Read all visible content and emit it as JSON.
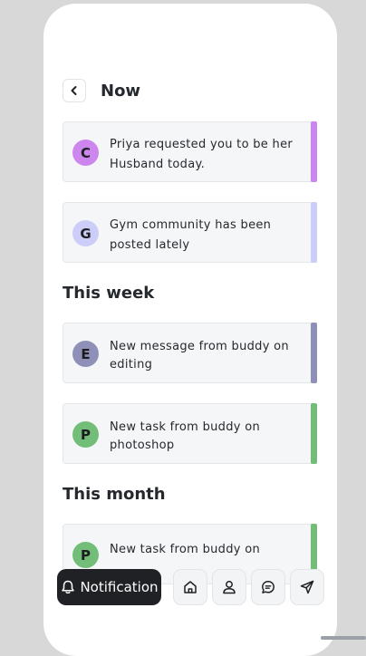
{
  "header": {
    "title": "Now"
  },
  "sections": [
    {
      "title": "This week"
    },
    {
      "title": "This month"
    }
  ],
  "notifications": [
    {
      "initial": "C",
      "text": "Priya requested you to be her Husband today.",
      "avatar_color": "#cc86ee",
      "bar_color": "#cc86ee"
    },
    {
      "initial": "G",
      "text": "Gym community has been posted lately",
      "avatar_color": "#cdcdf9",
      "bar_color": "#cdcdf9"
    },
    {
      "initial": "E",
      "text": "New message from buddy on editing",
      "avatar_color": "#8e90b7",
      "bar_color": "#8e90b7"
    },
    {
      "initial": "P",
      "text": "New task from buddy on photoshop",
      "avatar_color": "#72bd77",
      "bar_color": "#72bd77"
    },
    {
      "initial": "P",
      "text": "New task from buddy on",
      "avatar_color": "#72bd77",
      "bar_color": "#72bd77"
    }
  ],
  "nav": {
    "active_label": "Notification",
    "items": [
      {
        "icon": "bell-icon"
      },
      {
        "icon": "home-icon"
      },
      {
        "icon": "user-icon"
      },
      {
        "icon": "chat-icon"
      },
      {
        "icon": "send-icon"
      }
    ]
  }
}
